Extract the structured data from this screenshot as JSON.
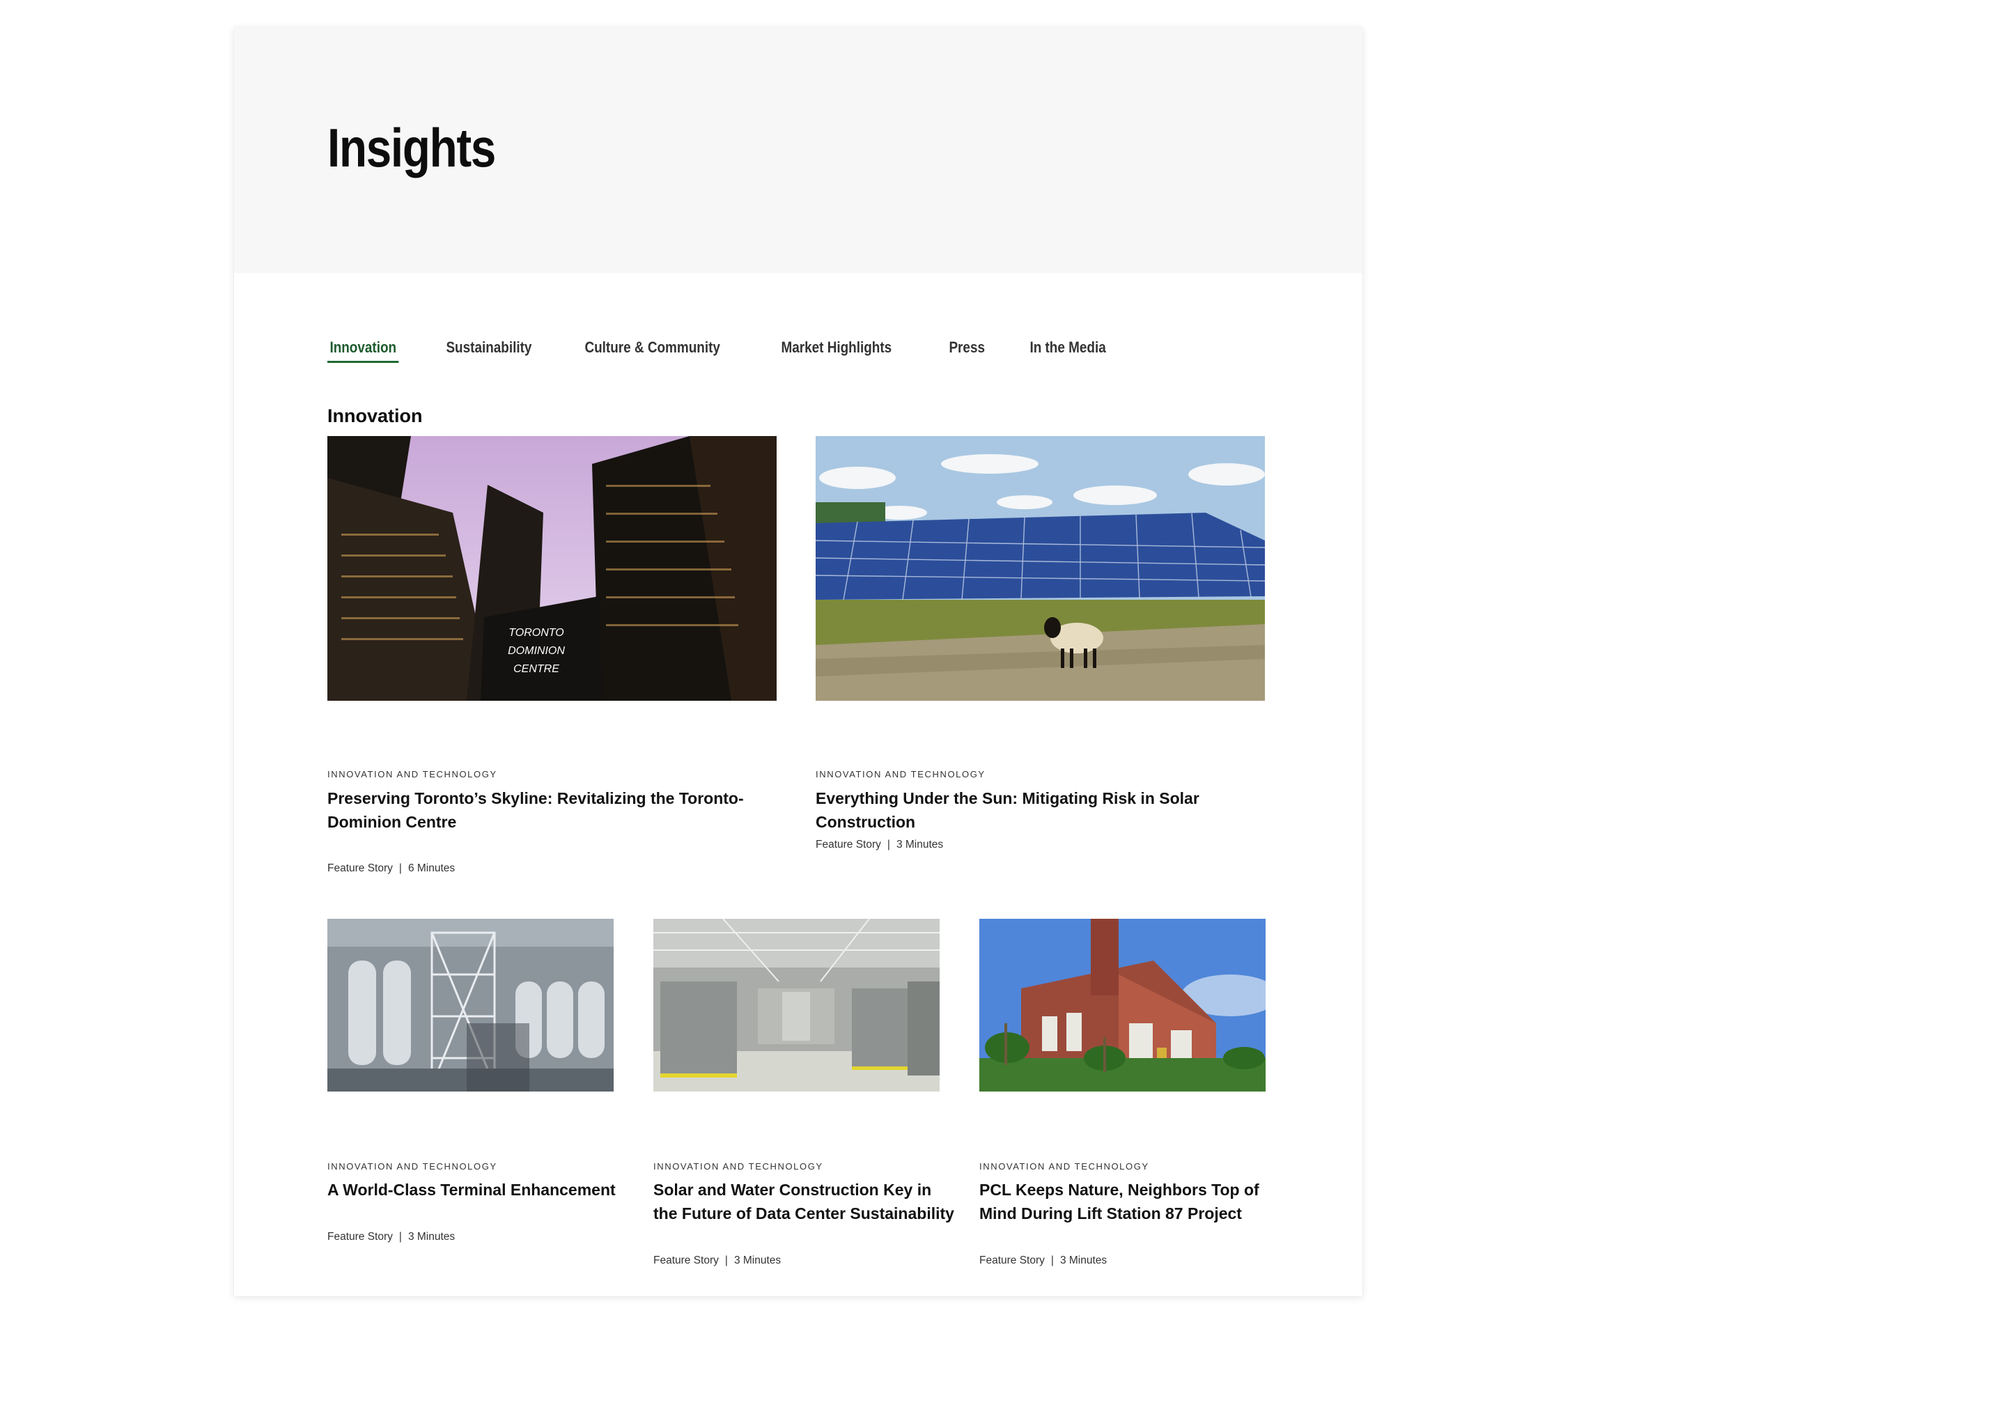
{
  "page": {
    "title": "Insights"
  },
  "tabs": [
    {
      "label": "Innovation",
      "active": true
    },
    {
      "label": "Sustainability",
      "active": false
    },
    {
      "label": "Culture & Community",
      "active": false
    },
    {
      "label": "Market Highlights",
      "active": false
    },
    {
      "label": "Press",
      "active": false
    },
    {
      "label": "In the Media",
      "active": false
    }
  ],
  "section": {
    "title": "Innovation"
  },
  "articles": [
    {
      "category": "INNOVATION AND TECHNOLOGY",
      "title": "Preserving Toronto’s Skyline: Revitalizing the Toronto-Dominion Centre",
      "type": "Feature Story",
      "separator": "|",
      "duration": "6 Minutes",
      "image_text": [
        "TORONTO",
        "DOMINION",
        "CENTRE"
      ]
    },
    {
      "category": "INNOVATION AND TECHNOLOGY",
      "title": "Everything Under the Sun: Mitigating Risk in Solar Construction",
      "type": "Feature Story",
      "separator": "|",
      "duration": "3 Minutes"
    },
    {
      "category": "INNOVATION AND TECHNOLOGY",
      "title": "A World-Class Terminal Enhancement",
      "type": "Feature Story",
      "separator": "|",
      "duration": "3 Minutes"
    },
    {
      "category": "INNOVATION AND TECHNOLOGY",
      "title": "Solar and Water Construction Key in the Future of Data Center Sustainability",
      "type": "Feature Story",
      "separator": "|",
      "duration": "3 Minutes"
    },
    {
      "category": "INNOVATION AND TECHNOLOGY",
      "title": "PCL Keeps Nature, Neighbors Top of Mind During Lift Station 87 Project",
      "type": "Feature Story",
      "separator": "|",
      "duration": "3 Minutes"
    }
  ],
  "colors": {
    "accent": "#1e6a32",
    "hero_bg": "#f7f7f7",
    "text": "#111111"
  }
}
